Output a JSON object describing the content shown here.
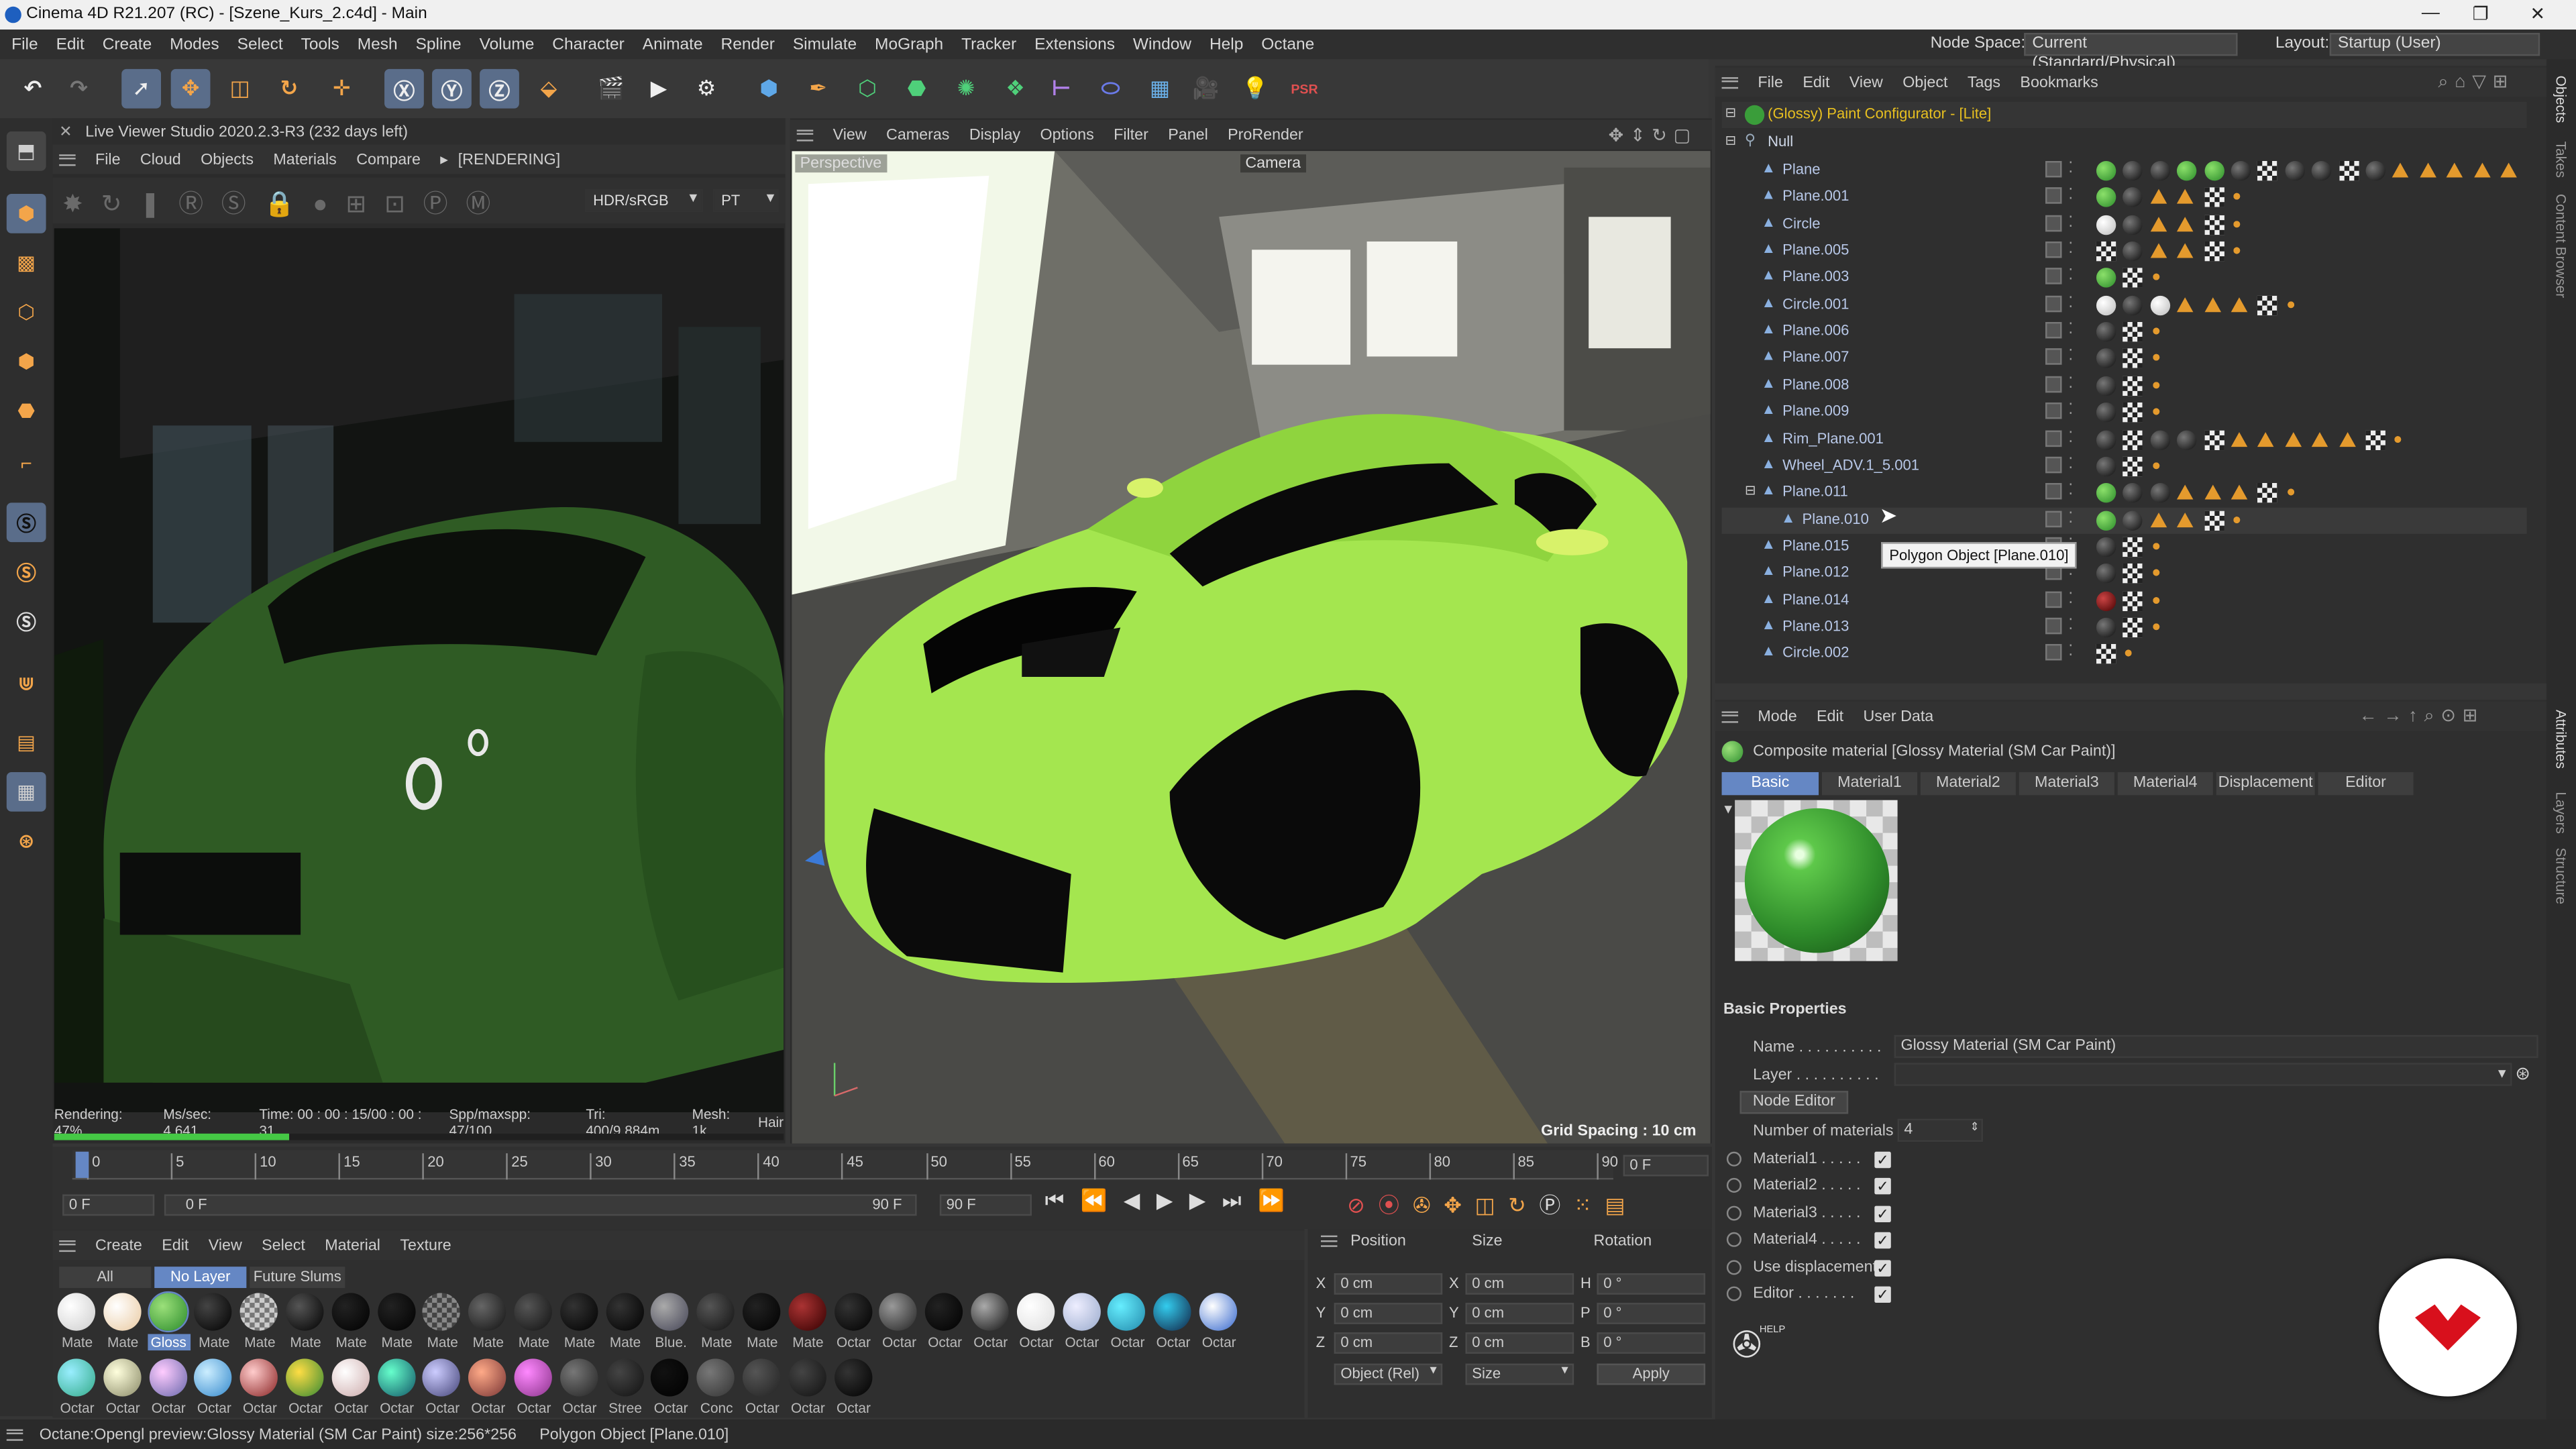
{
  "window": {
    "title": "Cinema 4D R21.207 (RC) - [Szene_Kurs_2.c4d] - Main",
    "controls": [
      "—",
      "❐",
      "✕"
    ]
  },
  "menu": {
    "items": [
      "File",
      "Edit",
      "Create",
      "Modes",
      "Select",
      "Tools",
      "Mesh",
      "Spline",
      "Volume",
      "Character",
      "Animate",
      "Render",
      "Simulate",
      "MoGraph",
      "Tracker",
      "Extensions",
      "Window",
      "Help",
      "Octane"
    ],
    "node_space_label": "Node Space:",
    "node_space_value": "Current (Standard/Physical)",
    "layout_label": "Layout:",
    "layout_value": "Startup (User)"
  },
  "live_viewer": {
    "title": "Live Viewer Studio 2020.2.3-R3 (232 days left)",
    "menu": [
      "File",
      "Cloud",
      "Objects",
      "Materials",
      "Compare"
    ],
    "state": "[RENDERING]",
    "colorspace": "HDR/sRGB",
    "kernel": "PT",
    "stats": {
      "rendering": "Rendering: 47%",
      "ms_sec": "Ms/sec: 4.641",
      "time": "Time: 00 : 00 : 15/00 : 00 : 31",
      "spp": "Spp/maxspp: 47/100",
      "tri": "Tri: 400/9.884m",
      "mesh": "Mesh: 1k",
      "hair": "Hair"
    },
    "progress": 0.47
  },
  "viewport": {
    "menu": [
      "View",
      "Cameras",
      "Display",
      "Options",
      "Filter",
      "Panel",
      "ProRender"
    ],
    "label": "Perspective",
    "camera": "Camera",
    "grid_spacing": "Grid Spacing : 10 cm"
  },
  "object_manager": {
    "menu": [
      "File",
      "Edit",
      "View",
      "Object",
      "Tags",
      "Bookmarks"
    ],
    "root": "(Glossy) Paint Configurator - [Lite]",
    "null": "Null",
    "objects": [
      "Plane",
      "Plane.001",
      "Circle",
      "Plane.005",
      "Plane.003",
      "Circle.001",
      "Plane.006",
      "Plane.007",
      "Plane.008",
      "Plane.009",
      "Rim_Plane.001",
      "Wheel_ADV.1_5.001",
      "Plane.011",
      "Plane.010",
      "Plane.015",
      "Plane.012",
      "Plane.014",
      "Plane.013",
      "Circle.002"
    ],
    "tooltip": "Polygon Object [Plane.010]"
  },
  "attributes": {
    "menu": [
      "Mode",
      "Edit",
      "User Data"
    ],
    "header": "Composite material [Glossy Material (SM Car Paint)]",
    "tabs": [
      "Basic",
      "Material1",
      "Material2",
      "Material3",
      "Material4",
      "Displacement",
      "Editor"
    ],
    "section": "Basic Properties",
    "name_label": "Name . . . . . . . . . .",
    "name_value": "Glossy Material (SM Car Paint)",
    "layer_label": "Layer . . . . . . . . . .",
    "node_editor": "Node Editor",
    "num_materials_label": "Number of materials",
    "num_materials_value": "4",
    "checks": [
      {
        "label": "Material1 . . . . .",
        "checked": true
      },
      {
        "label": "Material2 . . . . .",
        "checked": true
      },
      {
        "label": "Material3 . . . . .",
        "checked": true
      },
      {
        "label": "Material4 . . . . .",
        "checked": true
      },
      {
        "label": "Use displacement",
        "checked": true
      },
      {
        "label": "Editor . . . . . . .",
        "checked": true
      }
    ],
    "help": "HELP"
  },
  "timeline": {
    "ticks": [
      "0",
      "5",
      "10",
      "15",
      "20",
      "25",
      "30",
      "35",
      "40",
      "45",
      "50",
      "55",
      "60",
      "65",
      "70",
      "75",
      "80",
      "85",
      "90"
    ],
    "current_frame": "0 F",
    "start": "0 F",
    "preview_start": "0 F",
    "preview_end": "90 F",
    "end": "90 F",
    "frame_display": "0 F"
  },
  "material_manager": {
    "menu": [
      "Create",
      "Edit",
      "View",
      "Select",
      "Material",
      "Texture"
    ],
    "filters": [
      "All",
      "No Layer",
      "Future Slums"
    ],
    "row1": [
      "Mate",
      "Mate",
      "Gloss",
      "Mate",
      "Mate",
      "Mate",
      "Mate",
      "Mate",
      "Mate",
      "Mate",
      "Mate",
      "Mate",
      "Mate",
      "Blue.",
      "Mate",
      "Mate",
      "Mate",
      "Octar",
      "Octar",
      "Octar",
      "Octar",
      "Octar",
      "Octar",
      "Octar",
      "Octar",
      "Octar"
    ],
    "row2": [
      "Octar",
      "Octar",
      "Octar",
      "Octar",
      "Octar",
      "Octar",
      "Octar",
      "Octar",
      "Octar",
      "Octar",
      "Octar",
      "Octar",
      "Stree",
      "Octar",
      "Conc",
      "Octar",
      "Octar",
      "Octar"
    ]
  },
  "coordinates": {
    "headers": [
      "Position",
      "Size",
      "Rotation"
    ],
    "axes_pos": [
      "X",
      "Y",
      "Z"
    ],
    "axes_rot": [
      "H",
      "P",
      "B"
    ],
    "pos": [
      "0 cm",
      "0 cm",
      "0 cm"
    ],
    "size": [
      "0 cm",
      "0 cm",
      "0 cm"
    ],
    "rot": [
      "0 °",
      "0 °",
      "0 °"
    ],
    "mode": "Object (Rel)",
    "size_mode": "Size",
    "apply": "Apply"
  },
  "status": {
    "left": "Octane:Opengl preview:Glossy Material (SM Car Paint)  size:256*256",
    "right": "Polygon Object [Plane.010]"
  },
  "right_tabs": [
    "Objects",
    "Takes",
    "Content Browser",
    "Attributes",
    "Layers",
    "Structure"
  ],
  "colors": {
    "accent_orange": "#e49a2d",
    "car_green": "#9fe84a",
    "selection_blue": "#4a6fa8",
    "brand_red": "#d8101c"
  }
}
